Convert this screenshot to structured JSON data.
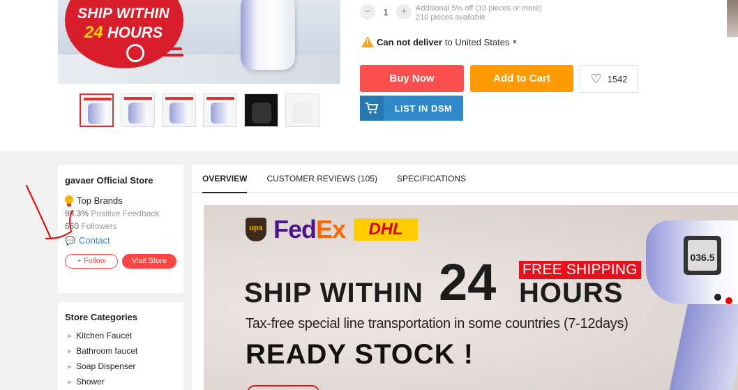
{
  "product": {
    "main_image": {
      "badge_line1": "SHIP WITHIN",
      "badge_number": "24",
      "badge_line2": " HOURS"
    },
    "quantity": {
      "value": "1",
      "minus": "−",
      "plus": "+"
    },
    "discount_note": "Additional 5% off (10 pieces or more)",
    "availability": "210 pieces available",
    "delivery": {
      "status": "Can not deliver",
      "destination": "to United States",
      "warn_symbol": "!"
    },
    "actions": {
      "buy_now": "Buy Now",
      "add_to_cart": "Add to Cart",
      "wishlist_count": "1542",
      "list_dsm": "LIST IN DSM"
    }
  },
  "store": {
    "name": "gavaer Official Store",
    "badge": "Top Brands",
    "positive_feedback_value": "98.3%",
    "positive_feedback_label": "Positive Feedback",
    "followers_value": "660",
    "followers_label": "Followers",
    "contact": "Contact",
    "follow_button": "+ Follow",
    "visit_button": "Visit Store"
  },
  "store_categories": {
    "title": "Store Categories",
    "items": [
      "Kitchen Faucet",
      "Bathroom faucet",
      "Soap Dispenser",
      "Shower"
    ]
  },
  "tabs": [
    "OVERVIEW",
    "CUSTOMER REVIEWS (105)",
    "SPECIFICATIONS"
  ],
  "banner": {
    "ups": "ups",
    "fedex_fe": "Fed",
    "fedex_ex": "Ex",
    "dhl": "DHL",
    "free_shipping": "FREE SHIPPING",
    "ship_within": "SHIP WITHIN",
    "hours_number": "24",
    "hours": "HOURS",
    "tax_free": "Tax-free special line transportation in some countries (7-12days)",
    "ready_stock": "READY STOCK !",
    "device_reading": "036.5"
  },
  "colors": {
    "buy_now": "#f94f4f",
    "add_to_cart": "#ff9a00",
    "dsm": "#2f88c9",
    "accent_red": "#e8101c"
  }
}
